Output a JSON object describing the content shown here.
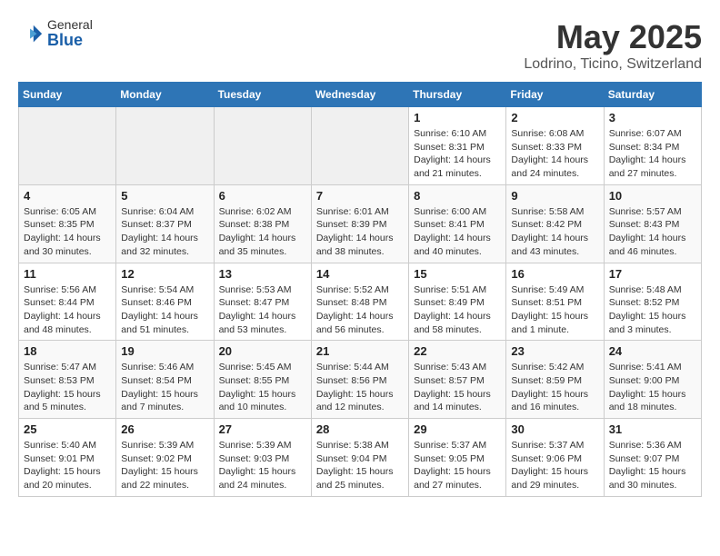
{
  "header": {
    "logo_general": "General",
    "logo_blue": "Blue",
    "title": "May 2025",
    "subtitle": "Lodrino, Ticino, Switzerland"
  },
  "days_of_week": [
    "Sunday",
    "Monday",
    "Tuesday",
    "Wednesday",
    "Thursday",
    "Friday",
    "Saturday"
  ],
  "weeks": [
    [
      {
        "day": "",
        "info": ""
      },
      {
        "day": "",
        "info": ""
      },
      {
        "day": "",
        "info": ""
      },
      {
        "day": "",
        "info": ""
      },
      {
        "day": "1",
        "info": "Sunrise: 6:10 AM\nSunset: 8:31 PM\nDaylight: 14 hours\nand 21 minutes."
      },
      {
        "day": "2",
        "info": "Sunrise: 6:08 AM\nSunset: 8:33 PM\nDaylight: 14 hours\nand 24 minutes."
      },
      {
        "day": "3",
        "info": "Sunrise: 6:07 AM\nSunset: 8:34 PM\nDaylight: 14 hours\nand 27 minutes."
      }
    ],
    [
      {
        "day": "4",
        "info": "Sunrise: 6:05 AM\nSunset: 8:35 PM\nDaylight: 14 hours\nand 30 minutes."
      },
      {
        "day": "5",
        "info": "Sunrise: 6:04 AM\nSunset: 8:37 PM\nDaylight: 14 hours\nand 32 minutes."
      },
      {
        "day": "6",
        "info": "Sunrise: 6:02 AM\nSunset: 8:38 PM\nDaylight: 14 hours\nand 35 minutes."
      },
      {
        "day": "7",
        "info": "Sunrise: 6:01 AM\nSunset: 8:39 PM\nDaylight: 14 hours\nand 38 minutes."
      },
      {
        "day": "8",
        "info": "Sunrise: 6:00 AM\nSunset: 8:41 PM\nDaylight: 14 hours\nand 40 minutes."
      },
      {
        "day": "9",
        "info": "Sunrise: 5:58 AM\nSunset: 8:42 PM\nDaylight: 14 hours\nand 43 minutes."
      },
      {
        "day": "10",
        "info": "Sunrise: 5:57 AM\nSunset: 8:43 PM\nDaylight: 14 hours\nand 46 minutes."
      }
    ],
    [
      {
        "day": "11",
        "info": "Sunrise: 5:56 AM\nSunset: 8:44 PM\nDaylight: 14 hours\nand 48 minutes."
      },
      {
        "day": "12",
        "info": "Sunrise: 5:54 AM\nSunset: 8:46 PM\nDaylight: 14 hours\nand 51 minutes."
      },
      {
        "day": "13",
        "info": "Sunrise: 5:53 AM\nSunset: 8:47 PM\nDaylight: 14 hours\nand 53 minutes."
      },
      {
        "day": "14",
        "info": "Sunrise: 5:52 AM\nSunset: 8:48 PM\nDaylight: 14 hours\nand 56 minutes."
      },
      {
        "day": "15",
        "info": "Sunrise: 5:51 AM\nSunset: 8:49 PM\nDaylight: 14 hours\nand 58 minutes."
      },
      {
        "day": "16",
        "info": "Sunrise: 5:49 AM\nSunset: 8:51 PM\nDaylight: 15 hours\nand 1 minute."
      },
      {
        "day": "17",
        "info": "Sunrise: 5:48 AM\nSunset: 8:52 PM\nDaylight: 15 hours\nand 3 minutes."
      }
    ],
    [
      {
        "day": "18",
        "info": "Sunrise: 5:47 AM\nSunset: 8:53 PM\nDaylight: 15 hours\nand 5 minutes."
      },
      {
        "day": "19",
        "info": "Sunrise: 5:46 AM\nSunset: 8:54 PM\nDaylight: 15 hours\nand 7 minutes."
      },
      {
        "day": "20",
        "info": "Sunrise: 5:45 AM\nSunset: 8:55 PM\nDaylight: 15 hours\nand 10 minutes."
      },
      {
        "day": "21",
        "info": "Sunrise: 5:44 AM\nSunset: 8:56 PM\nDaylight: 15 hours\nand 12 minutes."
      },
      {
        "day": "22",
        "info": "Sunrise: 5:43 AM\nSunset: 8:57 PM\nDaylight: 15 hours\nand 14 minutes."
      },
      {
        "day": "23",
        "info": "Sunrise: 5:42 AM\nSunset: 8:59 PM\nDaylight: 15 hours\nand 16 minutes."
      },
      {
        "day": "24",
        "info": "Sunrise: 5:41 AM\nSunset: 9:00 PM\nDaylight: 15 hours\nand 18 minutes."
      }
    ],
    [
      {
        "day": "25",
        "info": "Sunrise: 5:40 AM\nSunset: 9:01 PM\nDaylight: 15 hours\nand 20 minutes."
      },
      {
        "day": "26",
        "info": "Sunrise: 5:39 AM\nSunset: 9:02 PM\nDaylight: 15 hours\nand 22 minutes."
      },
      {
        "day": "27",
        "info": "Sunrise: 5:39 AM\nSunset: 9:03 PM\nDaylight: 15 hours\nand 24 minutes."
      },
      {
        "day": "28",
        "info": "Sunrise: 5:38 AM\nSunset: 9:04 PM\nDaylight: 15 hours\nand 25 minutes."
      },
      {
        "day": "29",
        "info": "Sunrise: 5:37 AM\nSunset: 9:05 PM\nDaylight: 15 hours\nand 27 minutes."
      },
      {
        "day": "30",
        "info": "Sunrise: 5:37 AM\nSunset: 9:06 PM\nDaylight: 15 hours\nand 29 minutes."
      },
      {
        "day": "31",
        "info": "Sunrise: 5:36 AM\nSunset: 9:07 PM\nDaylight: 15 hours\nand 30 minutes."
      }
    ]
  ]
}
